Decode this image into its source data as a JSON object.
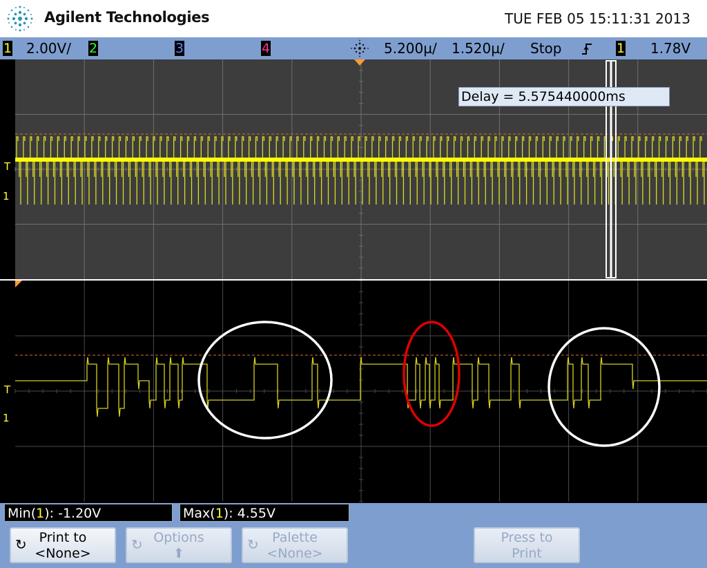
{
  "header": {
    "brand": "Agilent Technologies",
    "datetime": "TUE FEB 05 15:11:31 2013"
  },
  "status_bar": {
    "ch1_label": "1",
    "ch1_scale": "2.00V/",
    "ch2_label": "2",
    "ch3_label": "3",
    "ch4_label": "4",
    "time_position": "5.200µ/",
    "time_scale": "1.520µ/",
    "run_state": "Stop",
    "trigger_slope_icon": "rising-edge-icon",
    "trigger_channel": "1",
    "trigger_level": "1.78V",
    "colors": {
      "ch1": "#ffff33",
      "ch2": "#33ff33",
      "ch3": "#5577ff",
      "ch4": "#ff3388",
      "bar": "#7e9ecf"
    }
  },
  "scope": {
    "delay_label": "Delay = 5.575440000ms",
    "trigger_marker": "T",
    "ground_marker": "1",
    "main_trace_color": "#ffff33",
    "annotation_colors": {
      "white": "#ffffff",
      "red": "#e00000"
    }
  },
  "measurements": {
    "min_prefix": "Min(",
    "min_channel": "1",
    "min_value": "): -1.20V",
    "max_prefix": "Max(",
    "max_channel": "1",
    "max_value": "): 4.55V"
  },
  "softkeys": [
    {
      "line1": "Print to",
      "line2": "<None>",
      "icon": "rotate-arrow-icon",
      "enabled": true
    },
    {
      "line1": "Options",
      "line2": "⬆",
      "icon": "rotate-arrow-icon",
      "enabled": false
    },
    {
      "line1": "Palette",
      "line2": "<None>",
      "icon": "rotate-arrow-icon",
      "enabled": false
    },
    {
      "line1": "Press to",
      "line2": "Print",
      "icon": "",
      "enabled": false
    }
  ]
}
